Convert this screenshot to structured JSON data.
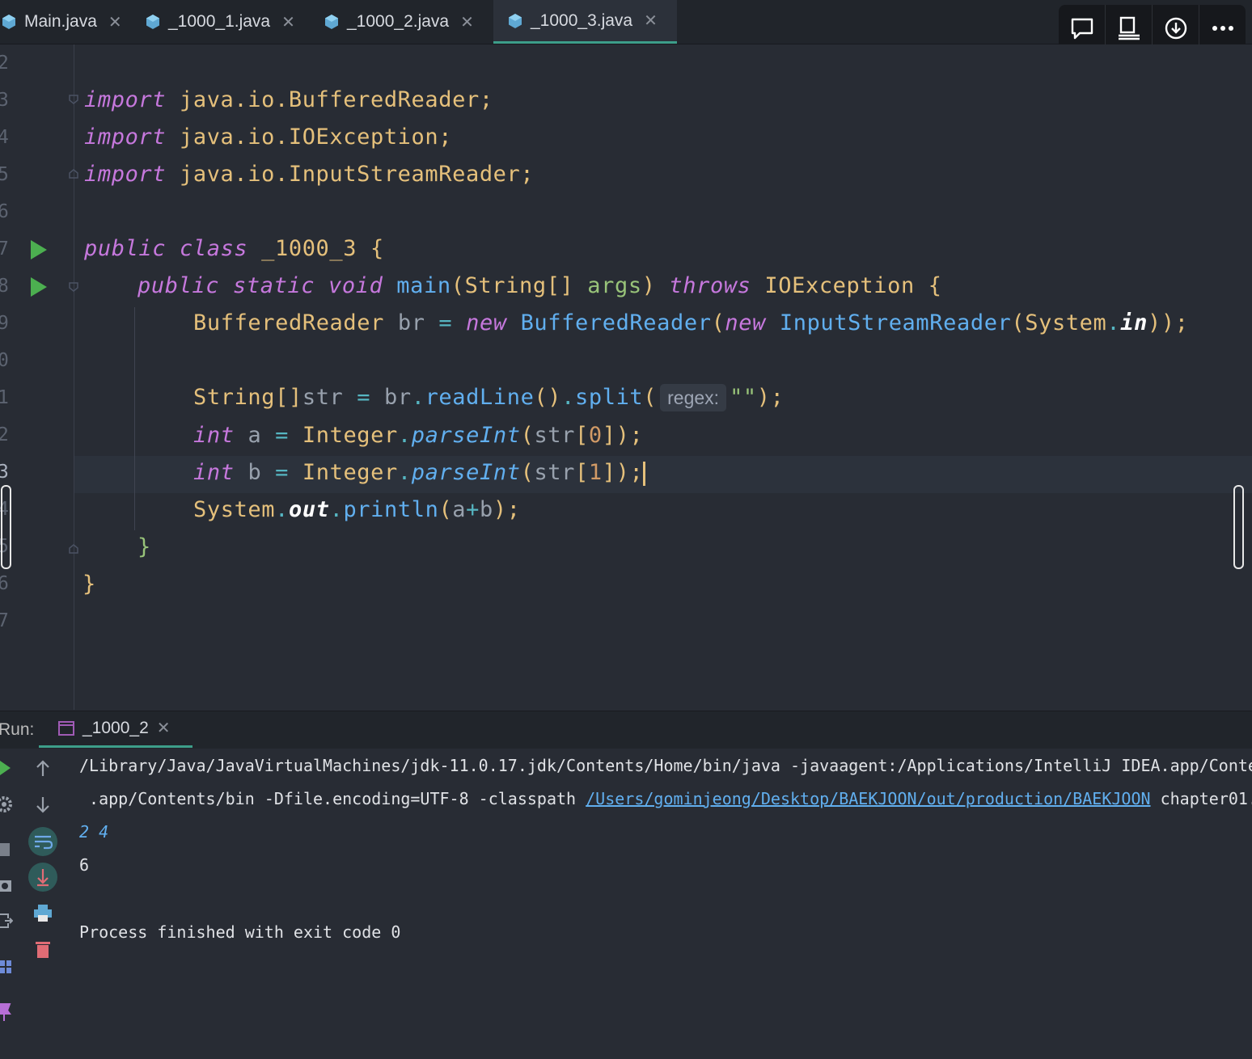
{
  "tabs": [
    {
      "label": "Main.java",
      "active": false
    },
    {
      "label": "_1000_1.java",
      "active": false
    },
    {
      "label": "_1000_2.java",
      "active": false
    },
    {
      "label": "_1000_3.java",
      "active": true
    }
  ],
  "toolbar": {
    "icons": [
      "comment-icon",
      "presentation-icon",
      "download-icon",
      "more-icon"
    ]
  },
  "editor": {
    "line_numbers": [
      "2",
      "3",
      "4",
      "5",
      "6",
      "7",
      "8",
      "9",
      "0",
      "1",
      "2",
      "3",
      "4",
      "5",
      "6",
      "7"
    ],
    "current_line_index": 11,
    "code": {
      "l3": {
        "kw": "import",
        "rest": " java.io.BufferedReader;"
      },
      "l4": {
        "kw": "import",
        "rest": " java.io.IOException;"
      },
      "l5": {
        "kw": "import",
        "rest": " java.io.InputStreamReader;"
      },
      "l7": {
        "kw1": "public",
        "kw2": "class",
        "name": "_1000_3",
        "brace": "{"
      },
      "l8": {
        "kw1": "public",
        "kw2": "static",
        "kw3": "void",
        "fn": "main",
        "p1": "(",
        "ty": "String[]",
        "param": "args",
        "p2": ")",
        "kw4": "throws",
        "ex": "IOException",
        "brace": "{"
      },
      "l9": {
        "ty": "BufferedReader",
        "var": "br",
        "eq": "=",
        "kw": "new",
        "fn1": "BufferedReader",
        "p1": "(",
        "kw2": "new",
        "fn2": "InputStreamReader",
        "p2": "(",
        "ty2": "System",
        "dot": ".",
        "field": "in",
        "end": "));"
      },
      "l11": {
        "ty": "String[]",
        "var": "str",
        "eq": "=",
        "var2": "br",
        "dot1": ".",
        "fn1": "readLine",
        "p1": "()",
        "dot2": ".",
        "fn2": "split",
        "p2": "(",
        "hint": "regex:",
        "str": "\"\"",
        "end": ");"
      },
      "l12": {
        "kw": "int",
        "var": "a",
        "eq": "=",
        "ty": "Integer",
        "dot": ".",
        "fn": "parseInt",
        "p1": "(",
        "var2": "str",
        "b1": "[",
        "num": "0",
        "end": "]);"
      },
      "l13": {
        "kw": "int",
        "var": "b",
        "eq": "=",
        "ty": "Integer",
        "dot": ".",
        "fn": "parseInt",
        "p1": "(",
        "var2": "str",
        "b1": "[",
        "num": "1",
        "end": "]);"
      },
      "l14": {
        "ty": "System",
        "dot": ".",
        "field": "out",
        "dot2": ".",
        "fn": "println",
        "p1": "(",
        "var": "a",
        "op": "+",
        "var2": "b",
        "end": ");"
      },
      "l15": {
        "brace": "}"
      },
      "l16": {
        "brace": "}"
      }
    }
  },
  "run": {
    "label": "Run:",
    "tab": "_1000_2",
    "console": {
      "line1": "/Library/Java/JavaVirtualMachines/jdk-11.0.17.jdk/Contents/Home/bin/java -javaagent:/Applications/IntelliJ IDEA.app/Conte",
      "line2_pre": " .app/Contents/bin -Dfile.encoding=UTF-8 -classpath ",
      "line2_link": "/Users/gominjeong/Desktop/BAEKJOON/out/production/BAEKJOON",
      "line2_post": " chapter01.",
      "input": "2 4",
      "output": "6",
      "finished": "Process finished with exit code 0"
    }
  },
  "colors": {
    "accent": "#3d9e8a",
    "keyword": "#c678dd",
    "type": "#e5c07b",
    "function": "#61afef",
    "string": "#98c379",
    "number": "#d19a66",
    "run_green": "#4caf50"
  }
}
